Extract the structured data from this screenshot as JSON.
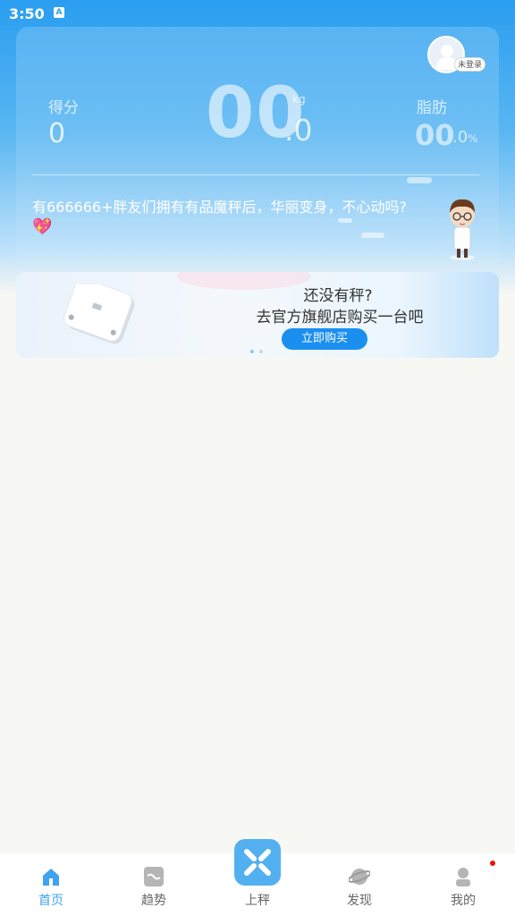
{
  "status_bar": {
    "time": "3:50",
    "indicator": "A"
  },
  "header": {
    "login_badge": "未登录",
    "score": {
      "label": "得分",
      "value": "0"
    },
    "weight": {
      "integer": "00",
      "decimal": ".0",
      "unit": "kg"
    },
    "fat": {
      "label": "脂肪",
      "integer": "00",
      "decimal": ".0",
      "unit": "%"
    },
    "promo_text": "有666666+胖友们拥有有品魔秤后，华丽变身，不心动吗?",
    "heart_icon": "sparkle-heart"
  },
  "banner": {
    "question": "还没有秤?",
    "subtitle": "去官方旗舰店购买一台吧",
    "button_label": "立即购买",
    "page_count": 2,
    "active_page": 1
  },
  "tabbar": {
    "tabs": [
      {
        "label": "首页",
        "icon": "home-icon",
        "active": true
      },
      {
        "label": "趋势",
        "icon": "trend-icon",
        "active": false
      },
      {
        "label": "上秤",
        "icon": "scale-icon",
        "active": false
      },
      {
        "label": "发现",
        "icon": "planet-icon",
        "active": false
      },
      {
        "label": "我的",
        "icon": "profile-icon",
        "active": false
      }
    ]
  },
  "colors": {
    "accent": "#3fa3ef",
    "button": "#1a8ff0",
    "badge": "#e3150f"
  }
}
